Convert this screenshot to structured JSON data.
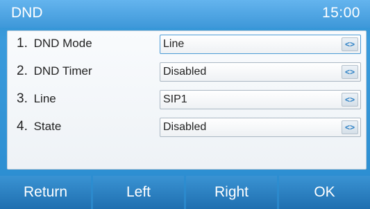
{
  "titlebar": {
    "title": "DND",
    "clock": "15:00"
  },
  "rows": [
    {
      "number": "1.",
      "label": "DND Mode",
      "value": "Line",
      "arrow_icon": "left-right-arrows-icon"
    },
    {
      "number": "2.",
      "label": "DND Timer",
      "value": "Disabled",
      "arrow_icon": "left-right-arrows-icon"
    },
    {
      "number": "3.",
      "label": "Line",
      "value": "SIP1",
      "arrow_icon": "left-right-arrows-icon"
    },
    {
      "number": "4.",
      "label": "State",
      "value": "Disabled",
      "arrow_icon": "left-right-arrows-icon"
    }
  ],
  "softkeys": {
    "return": "Return",
    "left": "Left",
    "right": "Right",
    "ok": "OK"
  },
  "arrow_glyph": "<>",
  "colors": {
    "accent": "#3a9bdc",
    "titlebar": "#4ea6e4",
    "softkey": "#2a80c2"
  }
}
